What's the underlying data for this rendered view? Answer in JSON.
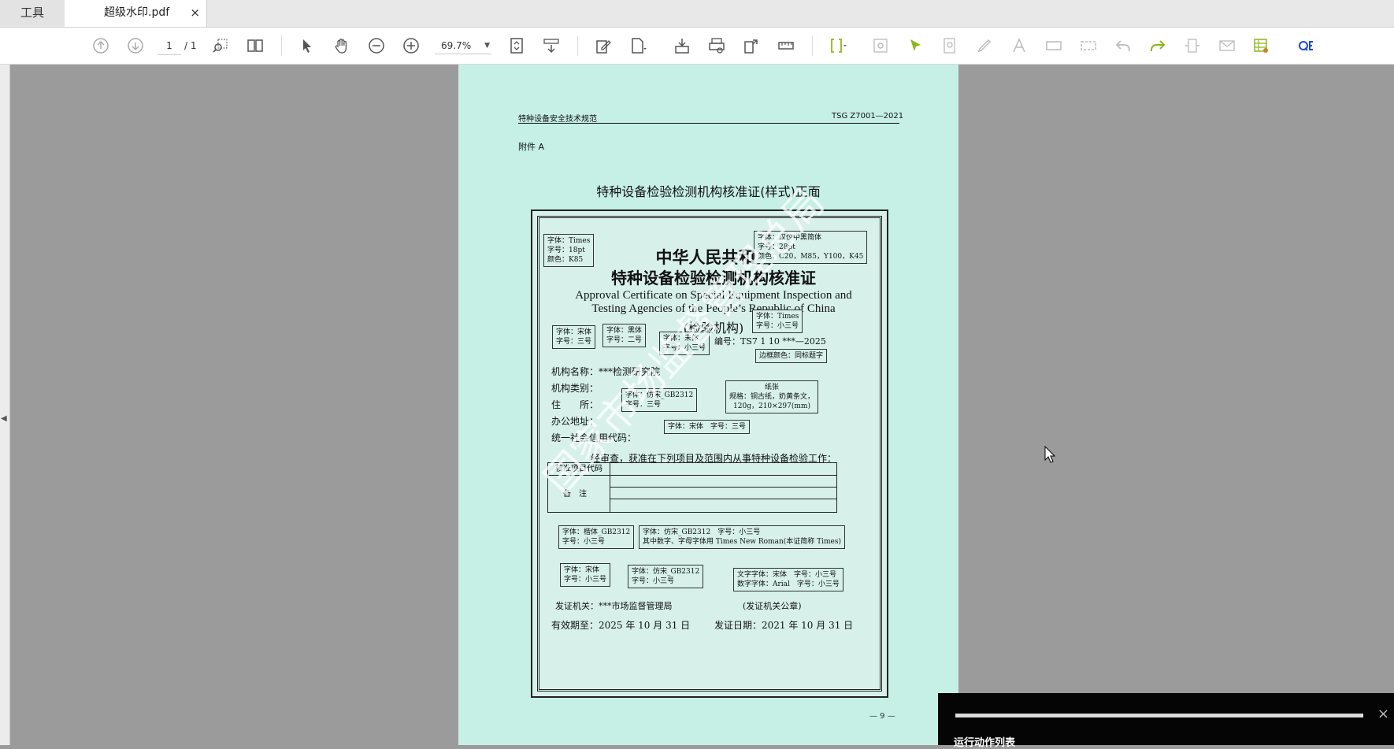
{
  "tabs": {
    "tools_label": "工具",
    "document_title": "超级水印.pdf",
    "close_symbol": "×"
  },
  "toolbar": {
    "page_current": "1",
    "page_total": "/ 1",
    "zoom": "69.7%"
  },
  "document": {
    "header_left": "特种设备安全技术规范",
    "header_right": "TSG Z7001—2021",
    "attachment": "附件 A",
    "title": "特种设备检验检测机构核准证(样式)正面",
    "page_number": "— 9 —",
    "watermark": "国家市场监督管理总局"
  },
  "certificate": {
    "title_cn_1": "中华人民共和国",
    "title_cn_2": "特种设备检验检测机构核准证",
    "title_en_1": "Approval Certificate on Special Equipment Inspection and",
    "title_en_2": "Testing Agencies of the People’s Republic of China",
    "subtitle": "(检验机构)",
    "serial": "编号：TS7 1 10 ***—2025",
    "org_name": "机构名称：***检测研究院",
    "org_type": "机构类别：",
    "address": "住　　所：",
    "office": "办公地址：",
    "credit_code": "统一社会信用代码：",
    "approval_text": "经审查，获准在下列项目及范围内从事特种设备检验工作：",
    "item_code": "核准项目代码",
    "remarks": "备注",
    "issuer": "发证机关：***市场监督管理局",
    "seal": "(发证机关公章)",
    "valid_until": "有效期至：2025 年 10 月 31 日",
    "issue_date": "发证日期：2021 年 10 月 31 日",
    "notes": [
      "字体：Times",
      "字号：18pt",
      "颜色：K85",
      "字体：汉仪中黑简体",
      "字号：28pt",
      "颜色：C20，M85，Y100，K45",
      "字体：Times",
      "字号：小三号",
      "字体：宋体",
      "字号：三号",
      "字体：黑体",
      "字号：二号",
      "字体：宋体",
      "字号：小三号",
      "边框颜色：同标题字",
      "纸张",
      "规格：铜古纸，奶黄条文，",
      "120g，210×297(mm)",
      "字体：仿宋_GB2312",
      "字号：三号",
      "字体：宋体　字号：三号",
      "字体：楷体_GB2312",
      "字号：小三号",
      "字体：仿宋_GB2312　字号：小三号",
      "其中数字、字母字体用 Times New Roman(本证简称 Times)",
      "字体：宋体",
      "字号：小三号",
      "字体：仿宋_GB2312",
      "字号：小三号",
      "文字字体：宋体　字号：小三号",
      "数字字体：Arial　字号：小三号"
    ]
  },
  "action_panel": {
    "label": "运行动作列表",
    "close_symbol": "×"
  }
}
